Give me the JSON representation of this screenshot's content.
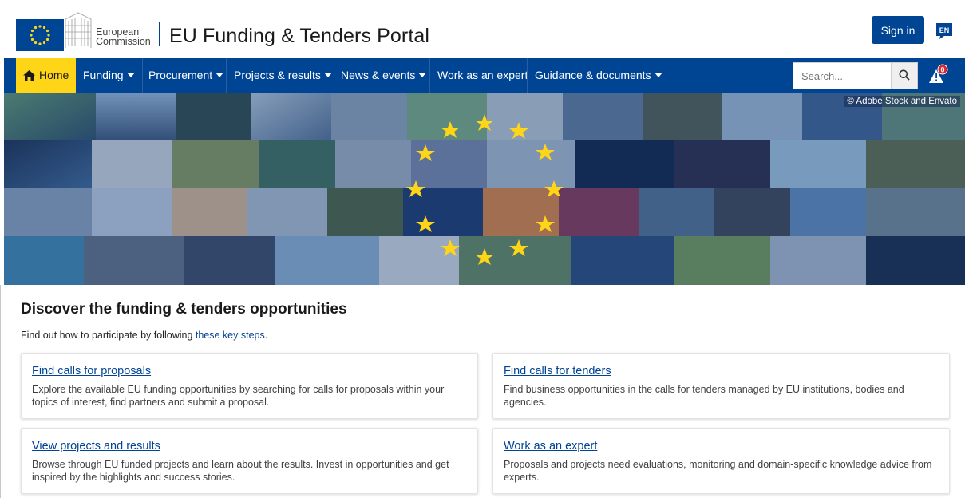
{
  "header": {
    "ec_line1": "European",
    "ec_line2": "Commission",
    "portal_title": "EU Funding & Tenders Portal",
    "signin_label": "Sign in",
    "lang_label": "EN"
  },
  "nav": {
    "items": [
      {
        "label": "Home",
        "active": true
      },
      {
        "label": "Funding",
        "dropdown": true
      },
      {
        "label": "Procurement",
        "dropdown": true
      },
      {
        "label": "Projects & results",
        "dropdown": true
      },
      {
        "label": "News & events",
        "dropdown": true
      },
      {
        "label": "Work as an expert",
        "dropdown": false
      },
      {
        "label": "Guidance & documents",
        "dropdown": true
      }
    ],
    "search_placeholder": "Search...",
    "alert_count": "0"
  },
  "banner": {
    "credit": "© Adobe Stock and Envato"
  },
  "main": {
    "title": "Discover the funding & tenders opportunities",
    "subtitle_prefix": "Find out how to participate by following ",
    "subtitle_link": "these key steps",
    "subtitle_suffix": ".",
    "cards": [
      {
        "title": "Find calls for proposals",
        "desc": "Explore the available EU funding opportunities by searching for calls for proposals within your topics of interest, find partners and submit a proposal."
      },
      {
        "title": "Find calls for tenders",
        "desc": "Find business opportunities in the calls for tenders managed by EU institutions, bodies and agencies."
      },
      {
        "title": "View projects and results",
        "desc": "Browse through EU funded projects and learn about the results. Invest in opportunities and get inspired by the highlights and success stories."
      },
      {
        "title": "Work as an expert",
        "desc": "Proposals and projects need evaluations, monitoring and domain-specific knowledge advice from experts."
      }
    ]
  },
  "colors": {
    "eu_blue": "#004494",
    "eu_yellow": "#ffd617",
    "link_blue": "#004494"
  },
  "icons": [
    "home-icon",
    "search-icon",
    "alert-icon",
    "eu-flag-icon",
    "caret-down-icon"
  ]
}
